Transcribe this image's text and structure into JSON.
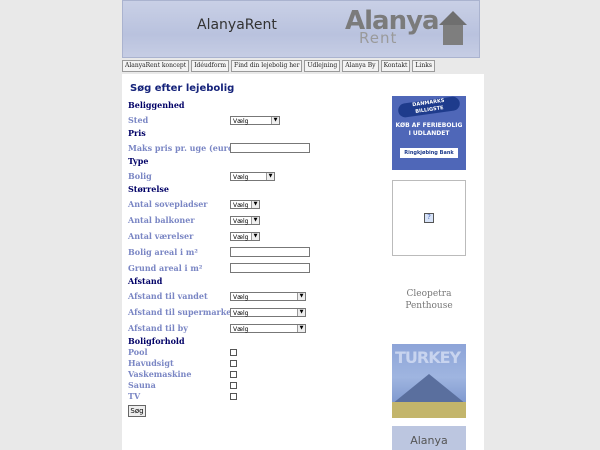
{
  "header": {
    "brand_text": "AlanyaRent",
    "logo_word": "Alanya",
    "logo_sub": "Rent"
  },
  "nav": [
    "AlanyaRent koncept",
    "Idéudform",
    "Find din lejebolig her",
    "Udlejning",
    "Alanya By",
    "Kontakt",
    "Links"
  ],
  "search": {
    "title": "Søg efter lejebolig",
    "sections": {
      "location": "Beliggenhed",
      "price": "Pris",
      "type": "Type",
      "size": "Størrelse",
      "distance": "Afstand",
      "conditions": "Boligforhold"
    },
    "fields": {
      "sted": {
        "label": "Sted",
        "value": "Vælg"
      },
      "maks_pris": {
        "label": "Maks pris pr. uge (euro)"
      },
      "bolig": {
        "label": "Bolig",
        "value": "Vælg"
      },
      "sovepladser": {
        "label": "Antal sovepladser",
        "value": "Vælg"
      },
      "balkoner": {
        "label": "Antal balkoner",
        "value": "Vælg"
      },
      "vaerelser": {
        "label": "Antal værelser",
        "value": "Vælg"
      },
      "bolig_areal": {
        "label": "Bolig areal i m²"
      },
      "grund_areal": {
        "label": "Grund areal i m²"
      },
      "afstand_vandet": {
        "label": "Afstand til vandet",
        "value": "Vælg"
      },
      "afstand_supermarked": {
        "label": "Afstand til supermarked",
        "value": "Vælg"
      },
      "afstand_by": {
        "label": "Afstand til by",
        "value": "Vælg"
      }
    },
    "conditions": [
      "Pool",
      "Havudsigt",
      "Vaskemaskine",
      "Sauna",
      "TV"
    ],
    "submit_label": "Søg"
  },
  "sidebar": {
    "bank_ad": {
      "badge": "DANMARKS BILLIGSTE",
      "headline": "KØB AF FERIEBOLIG I UDLANDET",
      "footer": "Ringkjøbing Bank"
    },
    "cleopetra": "Cleopetra Penthouse",
    "turkey_ad": {
      "word": "TURKEY"
    },
    "alanya_ad": "Alanya"
  },
  "colors": {
    "title": "#14227a",
    "section": "#000066",
    "label": "#7a86c4",
    "header_bg": "#c9d0e6"
  }
}
